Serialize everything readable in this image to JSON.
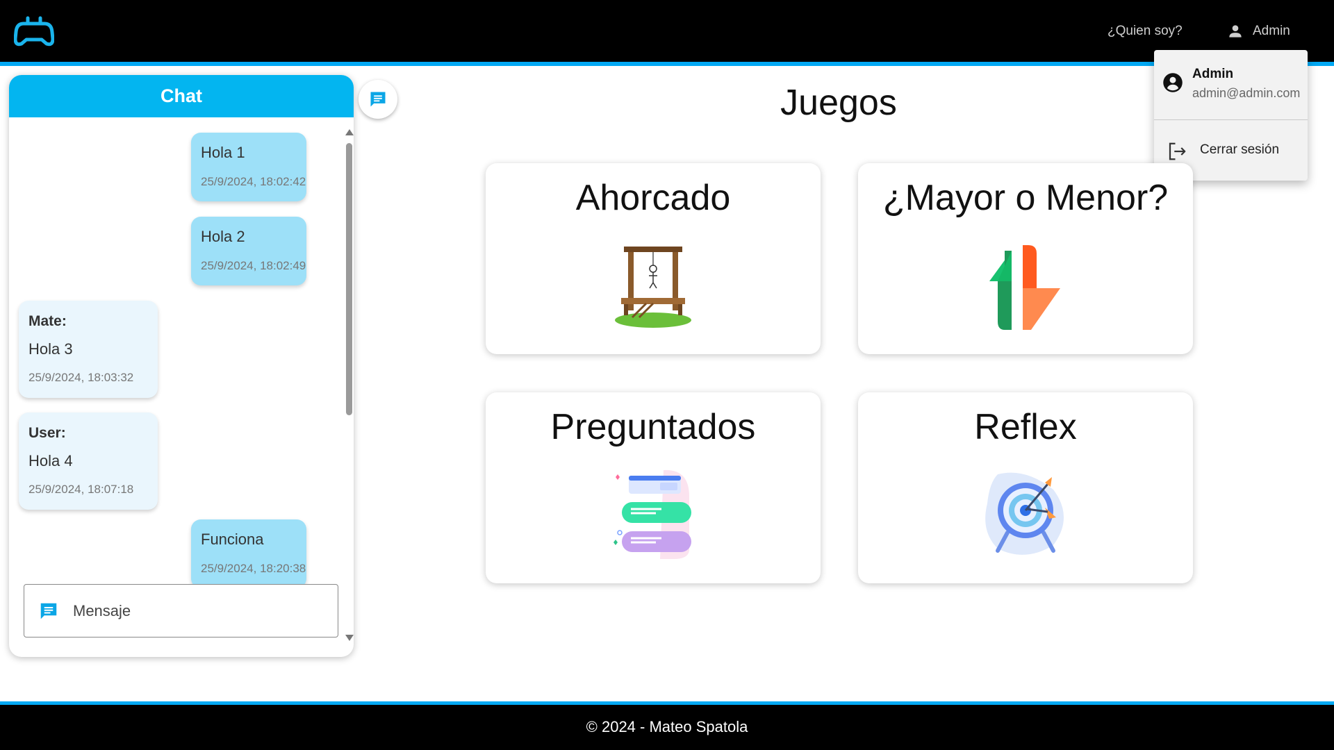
{
  "header": {
    "logo_icon": "gamepad-icon",
    "nav": {
      "whoami": "¿Quien soy?",
      "user": "Admin"
    }
  },
  "user_menu": {
    "name": "Admin",
    "email": "admin@admin.com",
    "logout": "Cerrar sesión"
  },
  "chat": {
    "title": "Chat",
    "messages": [
      {
        "author": "",
        "text": "Hola 1",
        "time": "25/9/2024, 18:02:42",
        "own": true
      },
      {
        "author": "",
        "text": "Hola 2",
        "time": "25/9/2024, 18:02:49",
        "own": true
      },
      {
        "author": "Mate:",
        "text": "Hola 3",
        "time": "25/9/2024, 18:03:32",
        "own": false
      },
      {
        "author": "User:",
        "text": "Hola 4",
        "time": "25/9/2024, 18:07:18",
        "own": false
      },
      {
        "author": "",
        "text": "Funciona",
        "time": "25/9/2024, 18:20:38",
        "own": true
      }
    ],
    "input_placeholder": "Mensaje"
  },
  "main": {
    "title": "Juegos",
    "games": [
      {
        "title": "Ahorcado",
        "icon": "gallows-icon"
      },
      {
        "title": "¿Mayor o Menor?",
        "icon": "up-down-arrows-icon"
      },
      {
        "title": "Preguntados",
        "icon": "quiz-icon"
      },
      {
        "title": "Reflex",
        "icon": "target-icon"
      }
    ]
  },
  "footer": {
    "text": "© 2024 - Mateo Spatola"
  },
  "colors": {
    "accent": "#03a9f4",
    "chat_header": "#03b5f0",
    "own_bubble": "#9de0f8",
    "other_bubble": "#eaf6fd"
  }
}
